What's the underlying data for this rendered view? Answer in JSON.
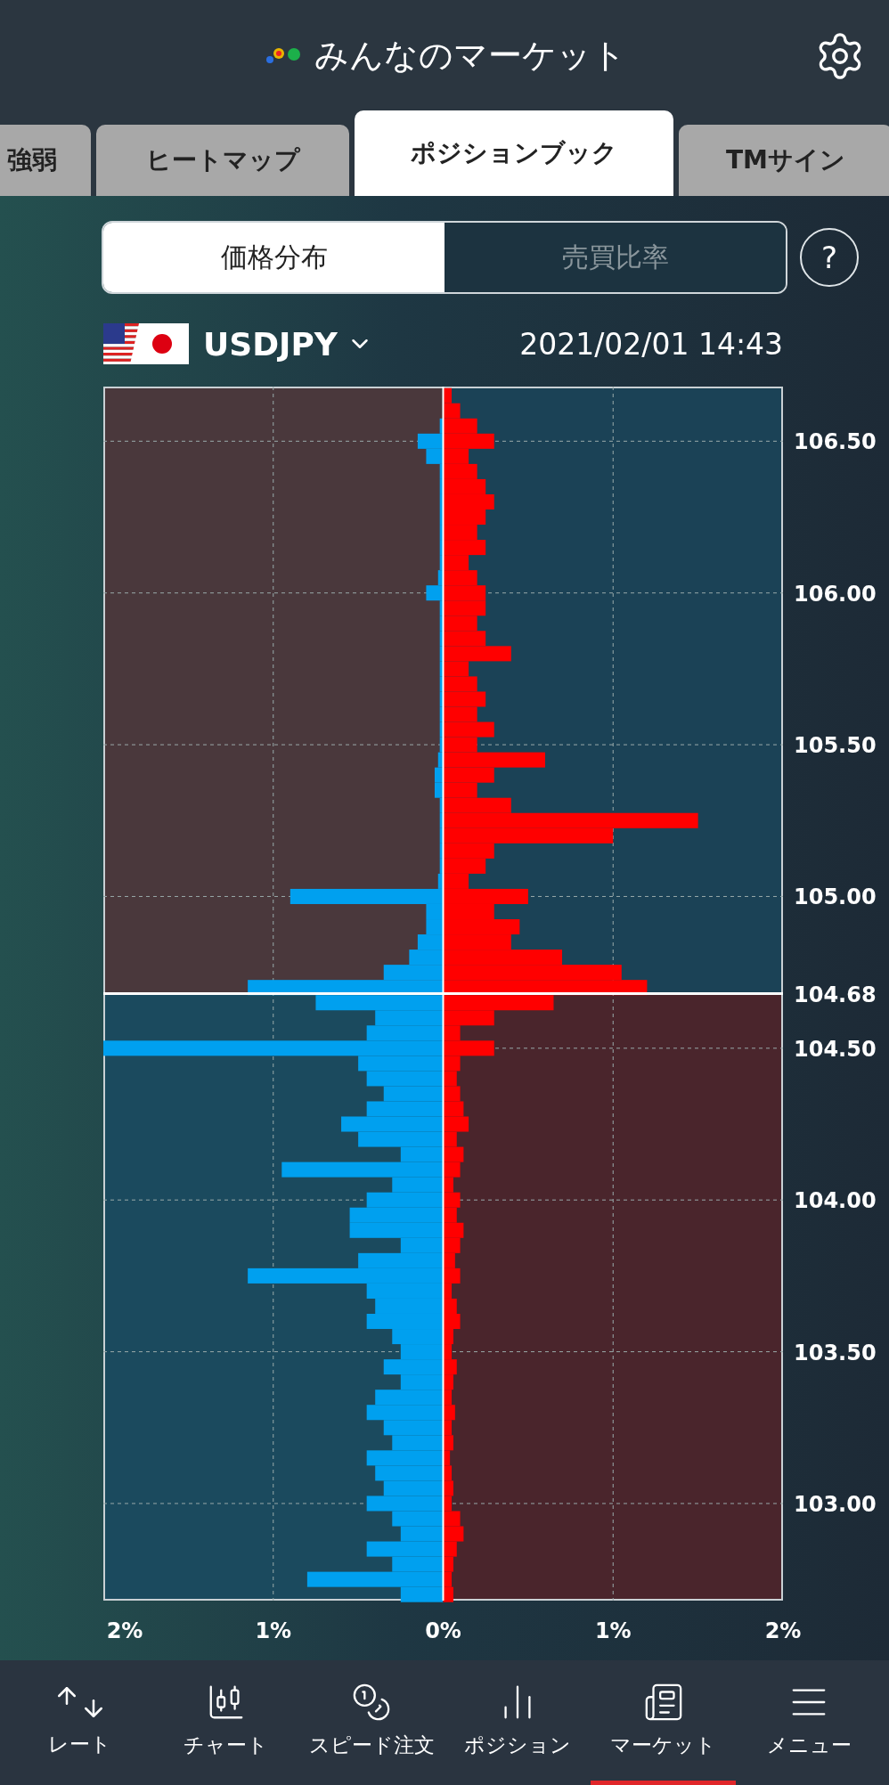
{
  "header": {
    "title": "みんなのマーケット"
  },
  "tabs": [
    {
      "label": "強弱",
      "selected": false
    },
    {
      "label": "ヒートマップ",
      "selected": false
    },
    {
      "label": "ポジションブック",
      "selected": true
    },
    {
      "label": "TMサイン",
      "selected": false
    }
  ],
  "segments": [
    {
      "label": "価格分布",
      "selected": true
    },
    {
      "label": "売買比率",
      "selected": false
    }
  ],
  "help": "?",
  "pair": {
    "name": "USDJPY",
    "datetime": "2021/02/01 14:43"
  },
  "chart_data": {
    "type": "bar",
    "orientation": "horizontal",
    "stacked": true,
    "grid": true,
    "x": [
      106.65,
      106.6,
      106.55,
      106.5,
      106.45,
      106.4,
      106.35,
      106.3,
      106.25,
      106.2,
      106.15,
      106.1,
      106.05,
      106.0,
      105.95,
      105.9,
      105.85,
      105.8,
      105.75,
      105.7,
      105.65,
      105.6,
      105.55,
      105.5,
      105.45,
      105.4,
      105.35,
      105.3,
      105.25,
      105.2,
      105.15,
      105.1,
      105.05,
      105.0,
      104.95,
      104.9,
      104.85,
      104.8,
      104.75,
      104.7,
      104.65,
      104.6,
      104.55,
      104.5,
      104.45,
      104.4,
      104.35,
      104.3,
      104.25,
      104.2,
      104.15,
      104.1,
      104.05,
      104.0,
      103.95,
      103.9,
      103.85,
      103.8,
      103.75,
      103.7,
      103.65,
      103.6,
      103.55,
      103.5,
      103.45,
      103.4,
      103.35,
      103.3,
      103.25,
      103.2,
      103.15,
      103.1,
      103.05,
      103.0,
      102.95,
      102.9,
      102.85,
      102.8,
      102.75,
      102.7
    ],
    "series": [
      {
        "color": "#00a0ef",
        "values": [
          0,
          0,
          -0.02,
          -0.15,
          -0.1,
          -0.02,
          -0.02,
          -0.02,
          -0.02,
          -0.02,
          -0.02,
          -0.02,
          -0.03,
          -0.1,
          -0.02,
          -0.02,
          -0.02,
          -0.02,
          -0.02,
          -0.02,
          -0.02,
          -0.02,
          -0.02,
          -0.02,
          -0.03,
          -0.05,
          -0.05,
          -0.02,
          -0.02,
          -0.02,
          -0.02,
          -0.02,
          -0.03,
          -0.9,
          -0.1,
          -0.1,
          -0.15,
          -0.2,
          -0.35,
          -1.15,
          -0.75,
          -0.4,
          -0.45,
          -2.0,
          -0.5,
          -0.45,
          -0.35,
          -0.45,
          -0.6,
          -0.5,
          -0.25,
          -0.95,
          -0.3,
          -0.45,
          -0.55,
          -0.55,
          -0.25,
          -0.5,
          -1.15,
          -0.45,
          -0.4,
          -0.45,
          -0.3,
          -0.25,
          -0.35,
          -0.25,
          -0.4,
          -0.45,
          -0.35,
          -0.3,
          -0.45,
          -0.4,
          -0.35,
          -0.45,
          -0.3,
          -0.25,
          -0.45,
          -0.3,
          -0.8,
          -0.25
        ]
      },
      {
        "color": "#ff0000",
        "values": [
          0.05,
          0.1,
          0.2,
          0.3,
          0.15,
          0.2,
          0.25,
          0.3,
          0.25,
          0.2,
          0.25,
          0.15,
          0.2,
          0.25,
          0.25,
          0.2,
          0.25,
          0.4,
          0.15,
          0.2,
          0.25,
          0.2,
          0.3,
          0.2,
          0.6,
          0.3,
          0.2,
          0.4,
          1.5,
          1.0,
          0.3,
          0.25,
          0.15,
          0.5,
          0.3,
          0.45,
          0.4,
          0.7,
          1.05,
          1.2,
          0.65,
          0.3,
          0.1,
          0.3,
          0.1,
          0.08,
          0.1,
          0.12,
          0.15,
          0.08,
          0.12,
          0.1,
          0.06,
          0.1,
          0.08,
          0.12,
          0.1,
          0.07,
          0.1,
          0.05,
          0.08,
          0.1,
          0.06,
          0.05,
          0.08,
          0.06,
          0.05,
          0.07,
          0.05,
          0.06,
          0.04,
          0.05,
          0.06,
          0.05,
          0.1,
          0.12,
          0.08,
          0.06,
          0.05,
          0.06
        ]
      }
    ],
    "xlim": [
      -2,
      2
    ],
    "xticks": [
      {
        "value": -2,
        "label": "2%"
      },
      {
        "value": -1,
        "label": "1%"
      },
      {
        "value": 0,
        "label": "0%"
      },
      {
        "value": 1,
        "label": "1%"
      },
      {
        "value": 2,
        "label": "2%"
      }
    ],
    "ylim": [
      102.68,
      106.68
    ],
    "yticks": [
      {
        "value": 106.5,
        "label": "106.50"
      },
      {
        "value": 106,
        "label": "106.00"
      },
      {
        "value": 105.5,
        "label": "105.50"
      },
      {
        "value": 105,
        "label": "105.00"
      },
      {
        "value": 104.5,
        "label": "104.50"
      },
      {
        "value": 104,
        "label": "104.00"
      },
      {
        "value": 103.5,
        "label": "103.50"
      },
      {
        "value": 103,
        "label": "103.00"
      }
    ],
    "ref_lines": [
      {
        "axis": "y",
        "value": 104.68,
        "label": "104.68"
      }
    ]
  },
  "nav": [
    {
      "label": "レート",
      "kind": "rate",
      "selected": false
    },
    {
      "label": "チャート",
      "kind": "chart",
      "selected": false
    },
    {
      "label": "スピード注文",
      "kind": "speed",
      "selected": false
    },
    {
      "label": "ポジション",
      "kind": "position",
      "selected": false
    },
    {
      "label": "マーケット",
      "kind": "market",
      "selected": true
    },
    {
      "label": "メニュー",
      "kind": "menu",
      "selected": false
    }
  ]
}
